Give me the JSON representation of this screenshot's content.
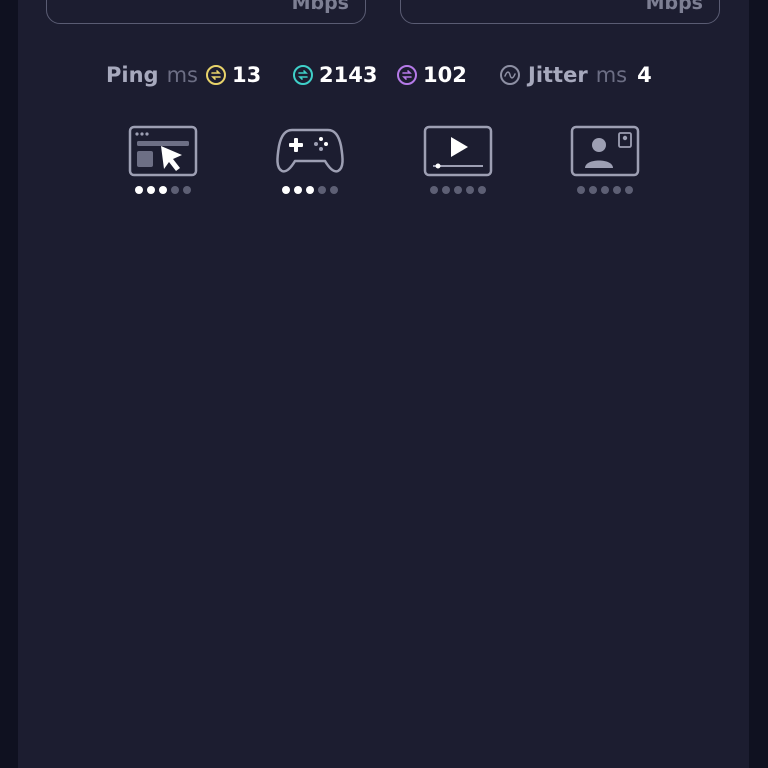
{
  "download": {
    "unit": "Mbps"
  },
  "upload": {
    "unit": "Mbps"
  },
  "metrics": {
    "ping": {
      "label": "Ping",
      "unit": "ms",
      "idle": "13",
      "download": "2143",
      "upload": "102"
    },
    "jitter": {
      "label": "Jitter",
      "unit": "ms",
      "value": "4"
    }
  },
  "colors": {
    "panel": "#1c1d30",
    "idle": "#e8d36a",
    "download": "#3fd0c9",
    "upload": "#b57ae8",
    "icon_stroke": "#9d9fb3",
    "dot_on": "#ffffff",
    "dot_off": "#5d5f74"
  },
  "categories": [
    {
      "icon": "web-browsing-icon",
      "rating": 3,
      "max": 5
    },
    {
      "icon": "gamepad-icon",
      "rating": 3,
      "max": 5
    },
    {
      "icon": "video-streaming-icon",
      "rating": 0,
      "max": 5
    },
    {
      "icon": "video-call-icon",
      "rating": 0,
      "max": 5
    }
  ]
}
